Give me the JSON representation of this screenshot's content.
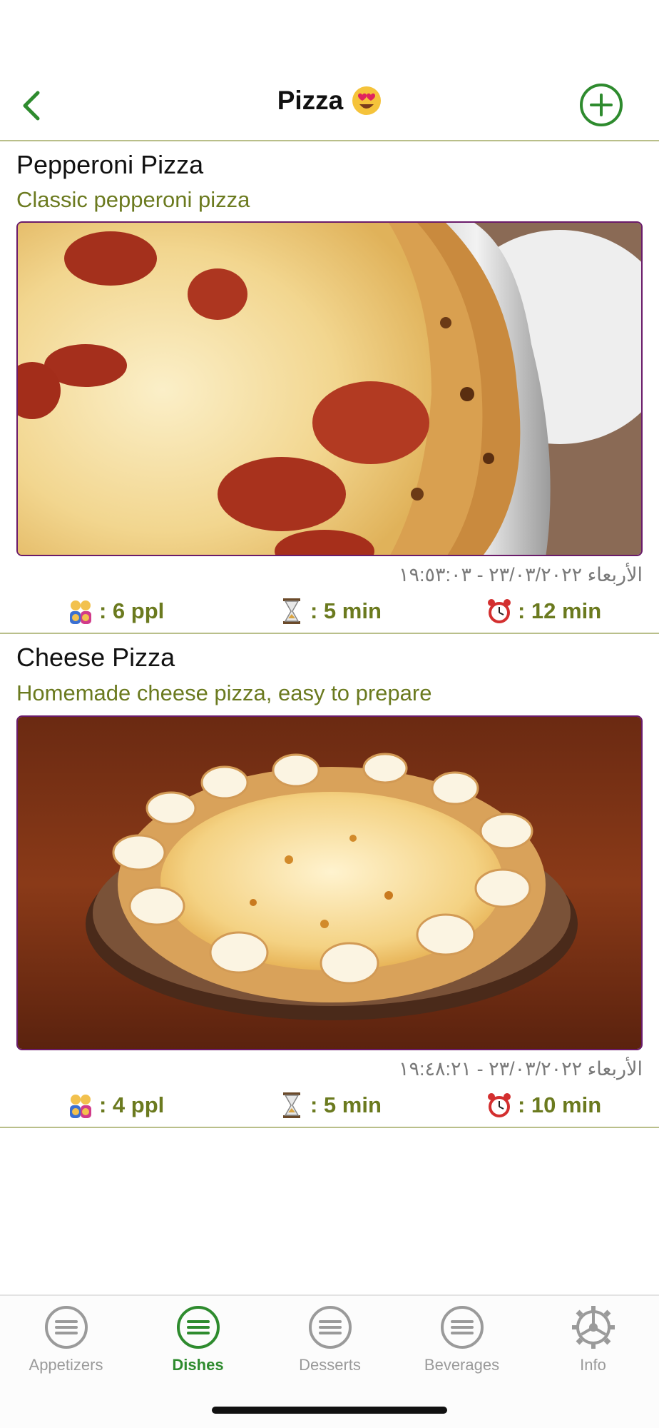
{
  "header": {
    "title": "Pizza",
    "title_emoji": "heart-eyes-emoji",
    "back_icon": "chevron-left-icon",
    "add_icon": "plus-circle-icon",
    "accent_color": "#2e8b2e"
  },
  "recipes": [
    {
      "name": "Pepperoni Pizza",
      "description": "Classic pepperoni pizza",
      "date": "الأربعاء ٢٣/٠٣/٢٠٢٢ - ١٩:٥٣:٠٣",
      "people": ": 6 ppl",
      "prep_time": ": 5 min",
      "cook_time": ": 12 min"
    },
    {
      "name": "Cheese Pizza",
      "description": "Homemade cheese pizza, easy to prepare",
      "date": "الأربعاء ٢٣/٠٣/٢٠٢٢ - ١٩:٤٨:٢١",
      "people": ": 4 ppl",
      "prep_time": ": 5 min",
      "cook_time": ": 10 min"
    }
  ],
  "tabs": [
    {
      "label": "Appetizers",
      "icon": "list-circle-icon",
      "active": false
    },
    {
      "label": "Dishes",
      "icon": "list-circle-icon",
      "active": true
    },
    {
      "label": "Desserts",
      "icon": "list-circle-icon",
      "active": false
    },
    {
      "label": "Beverages",
      "icon": "list-circle-icon",
      "active": false
    },
    {
      "label": "Info",
      "icon": "gear-icon",
      "active": false
    }
  ],
  "colors": {
    "desc_text": "#6b7a1f",
    "divider": "#b9bf8a",
    "photo_border": "#6a1b6a",
    "tab_active": "#2e8b2e",
    "tab_inactive": "#9a9a9a"
  }
}
